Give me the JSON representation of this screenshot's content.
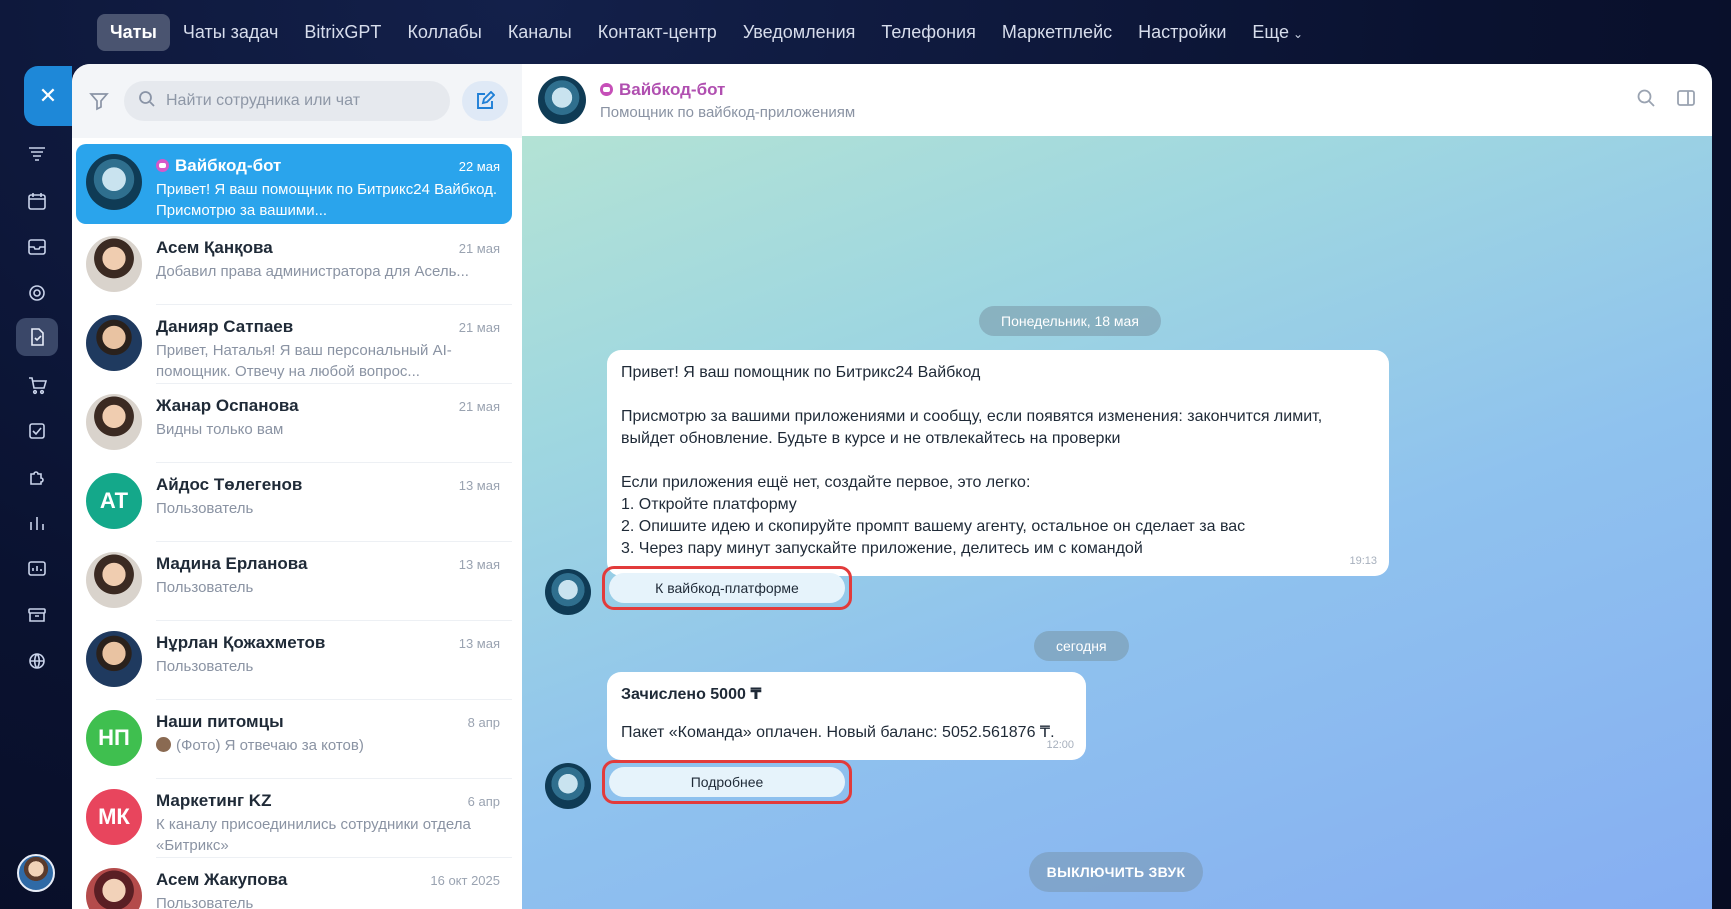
{
  "topnav": {
    "items": [
      "Чаты",
      "Чаты задач",
      "BitrixGPT",
      "Коллабы",
      "Каналы",
      "Контакт-центр",
      "Уведомления",
      "Телефония",
      "Маркетплейс",
      "Настройки",
      "Еще"
    ]
  },
  "rail": {
    "close_icon": "close-icon",
    "icons": [
      "filter-funnel-icon",
      "calendar-icon",
      "inbox-icon",
      "target-icon",
      "document-sign-icon",
      "cart-icon",
      "checkbox-icon",
      "puzzle-icon",
      "bar-chart-icon",
      "dashboard-icon",
      "archive-icon",
      "globe-icon"
    ]
  },
  "search": {
    "placeholder": "Найти сотрудника или чат"
  },
  "chats": [
    {
      "name": "Вайбкод-бот",
      "date": "22 мая",
      "preview": "Привет! Я ваш помощник по Битрикс24 Вайбкод. Присмотрю за вашими...",
      "bot": true
    },
    {
      "name": "Асем Қанқова",
      "date": "21 мая",
      "preview": "Добавил права администратора для Асель..."
    },
    {
      "name": "Данияр Сатпаев",
      "date": "21 мая",
      "preview": "Привет, Наталья! Я ваш персональный AI-помощник. Отвечу на любой вопрос..."
    },
    {
      "name": "Жанар Оспанова",
      "date": "21 мая",
      "preview": "Видны только вам"
    },
    {
      "name": "Айдос Төлегенов",
      "date": "13 мая",
      "preview": "Пользователь",
      "initials": "АТ"
    },
    {
      "name": "Мадина Ерланова",
      "date": "13 мая",
      "preview": "Пользователь"
    },
    {
      "name": "Нұрлан Қожахметов",
      "date": "13 мая",
      "preview": "Пользователь"
    },
    {
      "name": "Наши питомцы",
      "date": "8 апр",
      "preview": "(Фото) Я отвечаю за котов)",
      "initials": "НП"
    },
    {
      "name": "Маркетинг KZ",
      "date": "6 апр",
      "preview": "К каналу присоединились сотрудники отдела «Битрикс»",
      "initials": "МК"
    },
    {
      "name": "Асем Жакупова",
      "date": "16 окт 2025",
      "preview": "Пользователь"
    }
  ],
  "header": {
    "title": "Вайбкод-бот",
    "subtitle": "Помощник по вайбкод-приложениям"
  },
  "messages": {
    "date1": "Понедельник, 18 мая",
    "msg1": {
      "line1": "Привет! Я ваш помощник по Битрикс24 Вайбкод",
      "line2": "Присмотрю за вашими приложениями и сообщу, если появятся изменения: закончится лимит, выйдет обновление. Будьте в курсе и не отвлекайтесь на проверки",
      "line3": "Если приложения ещё нет, создайте первое, это легко:",
      "item1": "1. Откройте платформу",
      "item2": "2. Опишите идею и скопируйте промпт вашему агенту, остальное он сделает за вас",
      "item3": "3. Через пару минут запускайте приложение, делитесь им с командой",
      "time": "19:13"
    },
    "button1": "К вайбкод-платформе",
    "date2": "сегодня",
    "msg2": {
      "title": "Зачислено 5000 ₸",
      "text": "Пакет «Команда» оплачен. Новый баланс: 5052.561876 ₸.",
      "time": "12:00"
    },
    "button2": "Подробнее",
    "mute": "ВЫКЛЮЧИТЬ ЗВУК"
  }
}
